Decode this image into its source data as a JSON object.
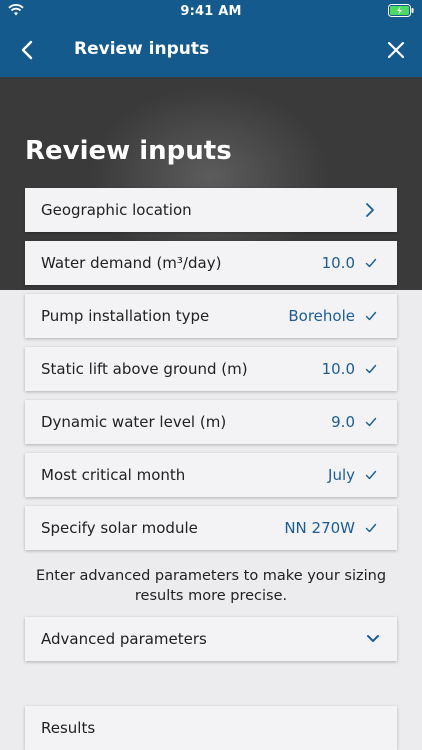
{
  "status": {
    "time": "9:41 AM"
  },
  "nav": {
    "title": "Review inputs"
  },
  "hero": {
    "title": "Review inputs"
  },
  "inputs": [
    {
      "label": "Geographic location",
      "value": "",
      "state": "chevron"
    },
    {
      "label": "Water demand (m³/day)",
      "value": "10.0",
      "state": "check"
    },
    {
      "label": "Pump installation type",
      "value": "Borehole",
      "state": "check"
    },
    {
      "label": "Static lift above ground (m)",
      "value": "10.0",
      "state": "check"
    },
    {
      "label": "Dynamic water level (m)",
      "value": "9.0",
      "state": "check"
    },
    {
      "label": "Most critical month",
      "value": "July",
      "state": "check"
    },
    {
      "label": "Specify solar module",
      "value": "NN 270W",
      "state": "check"
    }
  ],
  "info_text": "Enter advanced parameters to make your sizing results more precise.",
  "advanced": {
    "label": "Advanced parameters"
  },
  "results": {
    "label": "Results"
  },
  "colors": {
    "header": "#145a8d",
    "accent": "#1c5d93",
    "hero": "#3a3a3a",
    "background": "#ecebed"
  }
}
